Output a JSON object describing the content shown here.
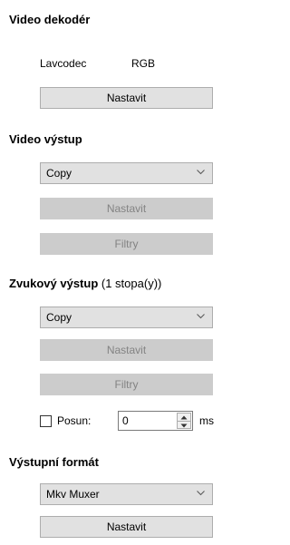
{
  "video_decoder": {
    "heading": "Video dekodér",
    "codec_name": "Lavcodec",
    "color_space": "RGB",
    "configure_label": "Nastavit"
  },
  "video_output": {
    "heading": "Video výstup",
    "selected": "Copy",
    "configure_label": "Nastavit",
    "filters_label": "Filtry"
  },
  "audio_output": {
    "heading": "Zvukový výstup",
    "track_count": "(1 stopa(y))",
    "selected": "Copy",
    "configure_label": "Nastavit",
    "filters_label": "Filtry",
    "shift_label": "Posun:",
    "shift_value": "0",
    "shift_unit": "ms",
    "shift_enabled": false
  },
  "output_format": {
    "heading": "Výstupní formát",
    "selected": "Mkv Muxer",
    "configure_label": "Nastavit"
  },
  "icons": {
    "dropdown": "chevron-down-icon",
    "spin_up": "arrow-up-icon",
    "spin_down": "arrow-down-icon"
  }
}
